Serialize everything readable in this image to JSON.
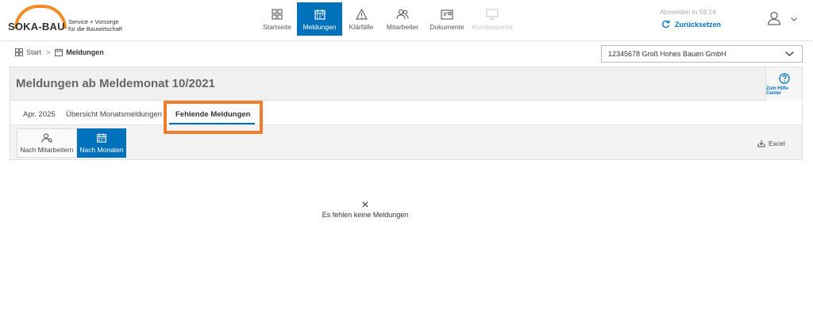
{
  "brand": {
    "name": "SOKA-BAU",
    "tagline_1": "Service + Vorsorge",
    "tagline_2": "für die Bauwirtschaft",
    "accent": "#f28c28"
  },
  "nav": [
    {
      "label": "Startseite",
      "icon": "grid-icon",
      "state": "normal"
    },
    {
      "label": "Meldungen",
      "icon": "calendar-icon",
      "state": "active"
    },
    {
      "label": "Klärfälle",
      "icon": "warning-icon",
      "state": "normal"
    },
    {
      "label": "Mitarbeiter",
      "icon": "users-icon",
      "state": "normal"
    },
    {
      "label": "Dokumente",
      "icon": "mail-icon",
      "state": "normal"
    },
    {
      "label": "Kundenportal",
      "icon": "monitor-icon",
      "state": "disabled"
    }
  ],
  "session": {
    "logout_text": "Abmelden in 59:14",
    "reset_label": "Zurücksetzen"
  },
  "breadcrumb": {
    "home": "Start",
    "separator": ">",
    "current": "Meldungen"
  },
  "company_select": {
    "value": "12345678 Groß Hohes Bauen GmbH"
  },
  "panel": {
    "title": "Meldungen ab Meldemonat 10/2021",
    "help_label": "Zum Hilfe-Center"
  },
  "tabs": [
    {
      "label": "Apr. 2025",
      "active": false
    },
    {
      "label": "Übersicht Monatsmeldungen",
      "active": false
    },
    {
      "label": "Fehlende Meldungen",
      "active": true
    }
  ],
  "views": [
    {
      "label": "Nach Mitarbeitern",
      "icon": "user-search-icon",
      "active": false
    },
    {
      "label": "Nach Monaten",
      "icon": "calendar-icon",
      "active": true
    }
  ],
  "export": {
    "label": "Excel"
  },
  "empty_state": {
    "message": "Es fehlen keine Meldungen"
  },
  "colors": {
    "primary": "#0072bc",
    "highlight": "#f07d2d"
  }
}
